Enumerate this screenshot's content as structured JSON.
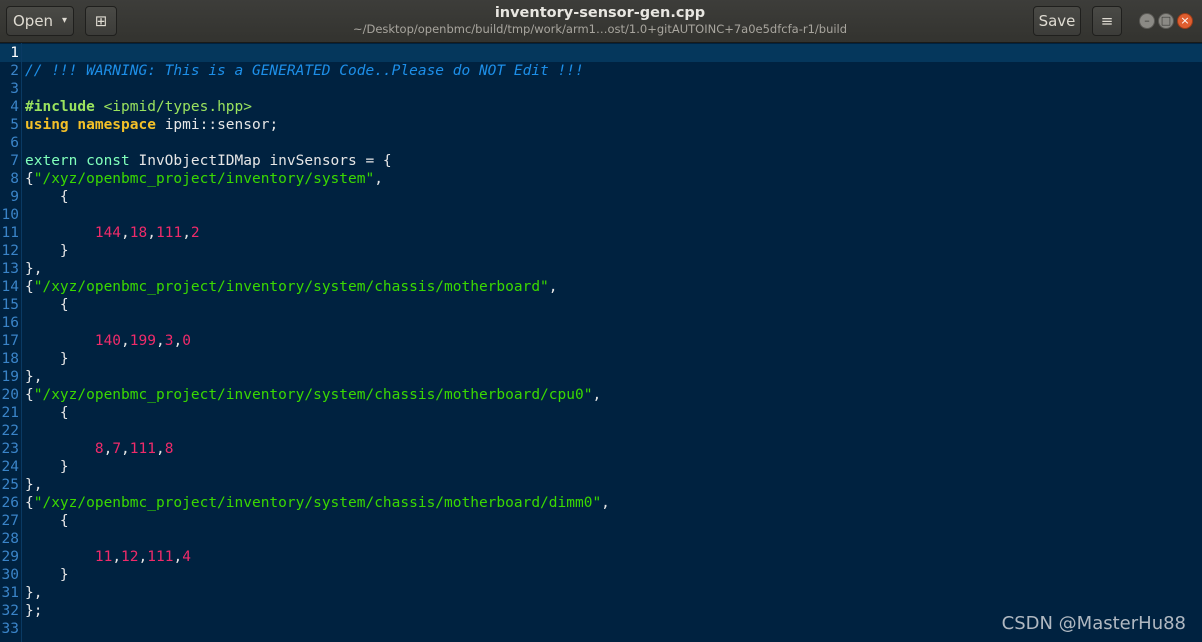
{
  "header": {
    "open_label": "Open",
    "open_caret": "▾",
    "new_tab_icon": "⊞",
    "title": "inventory-sensor-gen.cpp",
    "subtitle": "~/Desktop/openbmc/build/tmp/work/arm1…ost/1.0+gitAUTOINC+7a0e5dfcfa-r1/build",
    "save_label": "Save",
    "menu_icon": "≡",
    "minimize_glyph": "–",
    "maximize_glyph": "□",
    "close_glyph": "×"
  },
  "colors": {
    "editor_bg": "#002240",
    "comment": "#1d8fe8",
    "keyword": "#f3c028",
    "string": "#3ad900",
    "number": "#ef2b6a"
  },
  "editor": {
    "current_line": 1,
    "lines": [
      [],
      [
        [
          "cmt",
          "// !!! WARNING: This is a GENERATED Code..Please do NOT Edit !!!"
        ]
      ],
      [],
      [
        [
          "pre",
          "#include "
        ],
        [
          "hdr",
          "<ipmid/types.hpp>"
        ]
      ],
      [
        [
          "kw",
          "using"
        ],
        [
          "",
          "  "
        ],
        [
          "kw",
          "namespace"
        ],
        [
          "",
          ""
        ],
        [
          "",
          "ipmi::sensor;"
        ]
      ],
      [],
      [
        [
          "type",
          "extern const"
        ],
        [
          "",
          " InvObjectIDMap invSensors = {"
        ]
      ],
      [
        [
          "",
          "{"
        ],
        [
          "str",
          "\"/xyz/openbmc_project/inventory/system\""
        ],
        [
          "",
          ","
        ]
      ],
      [
        [
          "",
          "    {"
        ]
      ],
      [],
      [
        [
          "",
          "        "
        ],
        [
          "num",
          "144"
        ],
        [
          "",
          ","
        ],
        [
          "num",
          "18"
        ],
        [
          "",
          ","
        ],
        [
          "num",
          "111"
        ],
        [
          "",
          ","
        ],
        [
          "num",
          "2"
        ]
      ],
      [
        [
          "",
          "    }"
        ]
      ],
      [
        [
          "",
          "},"
        ]
      ],
      [
        [
          "",
          "{"
        ],
        [
          "str",
          "\"/xyz/openbmc_project/inventory/system/chassis/motherboard\""
        ],
        [
          "",
          ","
        ]
      ],
      [
        [
          "",
          "    {"
        ]
      ],
      [],
      [
        [
          "",
          "        "
        ],
        [
          "num",
          "140"
        ],
        [
          "",
          ","
        ],
        [
          "num",
          "199"
        ],
        [
          "",
          ","
        ],
        [
          "num",
          "3"
        ],
        [
          "",
          ","
        ],
        [
          "num",
          "0"
        ]
      ],
      [
        [
          "",
          "    }"
        ]
      ],
      [
        [
          "",
          "},"
        ]
      ],
      [
        [
          "",
          "{"
        ],
        [
          "str",
          "\"/xyz/openbmc_project/inventory/system/chassis/motherboard/cpu0\""
        ],
        [
          "",
          ","
        ]
      ],
      [
        [
          "",
          "    {"
        ]
      ],
      [],
      [
        [
          "",
          "        "
        ],
        [
          "num",
          "8"
        ],
        [
          "",
          ","
        ],
        [
          "num",
          "7"
        ],
        [
          "",
          ","
        ],
        [
          "num",
          "111"
        ],
        [
          "",
          ","
        ],
        [
          "num",
          "8"
        ]
      ],
      [
        [
          "",
          "    }"
        ]
      ],
      [
        [
          "",
          "},"
        ]
      ],
      [
        [
          "",
          "{"
        ],
        [
          "str",
          "\"/xyz/openbmc_project/inventory/system/chassis/motherboard/dimm0\""
        ],
        [
          "",
          ","
        ]
      ],
      [
        [
          "",
          "    {"
        ]
      ],
      [],
      [
        [
          "",
          "        "
        ],
        [
          "num",
          "11"
        ],
        [
          "",
          ","
        ],
        [
          "num",
          "12"
        ],
        [
          "",
          ","
        ],
        [
          "num",
          "111"
        ],
        [
          "",
          ","
        ],
        [
          "num",
          "4"
        ]
      ],
      [
        [
          "",
          "    }"
        ]
      ],
      [
        [
          "",
          "},"
        ]
      ],
      [
        [
          "",
          "};"
        ]
      ],
      []
    ]
  },
  "watermark": "CSDN @MasterHu88"
}
